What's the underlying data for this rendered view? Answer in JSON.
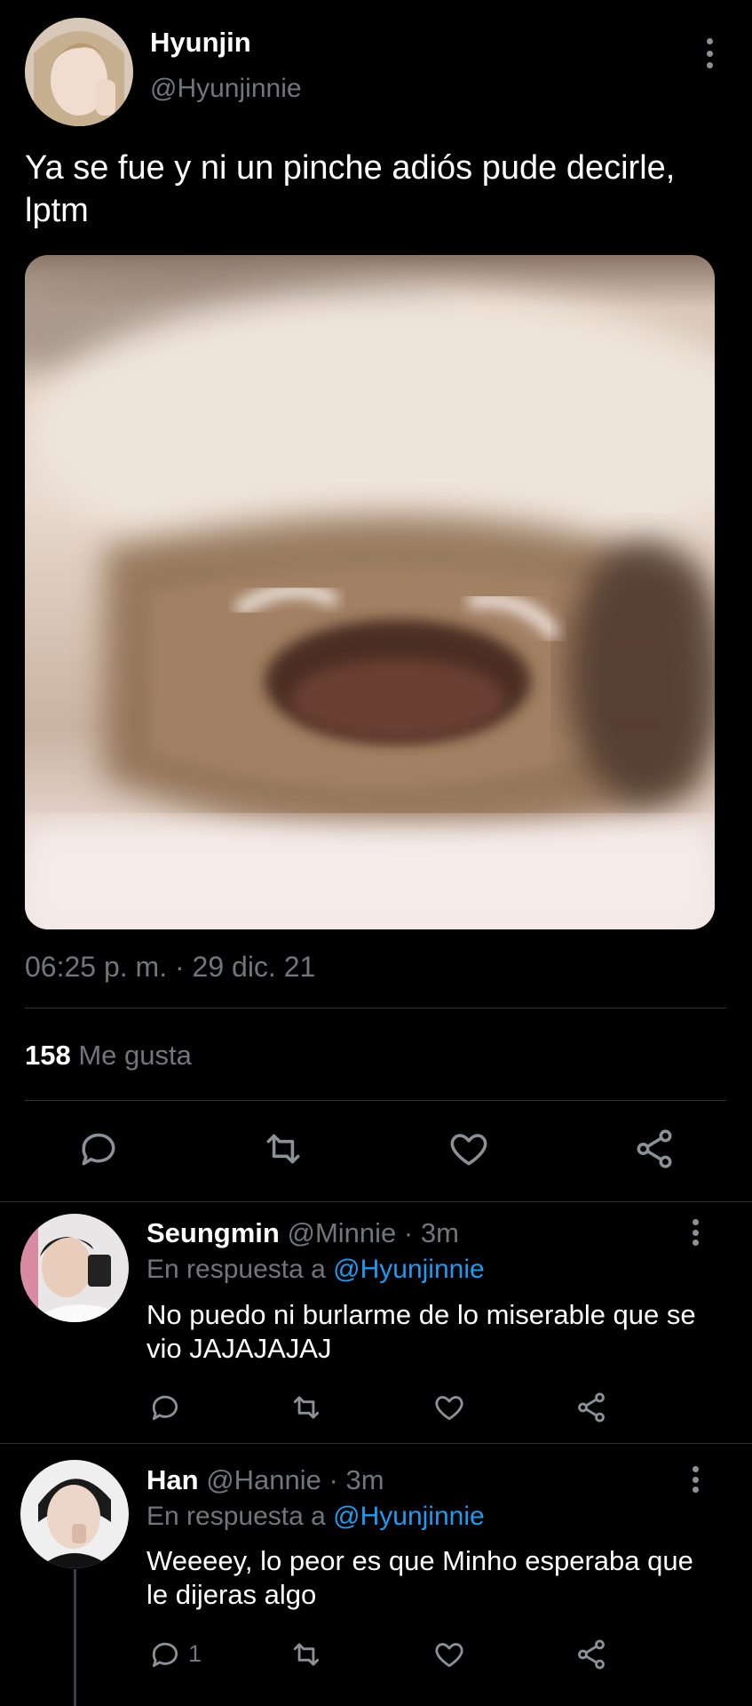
{
  "main_tweet": {
    "author_name": "Hyunjin",
    "author_handle": "@Hyunjinnie",
    "text": "Ya se fue y ni un pinche adiós pude decirle, lptm",
    "timestamp": "06:25 p. m. · 29 dic. 21",
    "likes_count": "158",
    "likes_label": "Me gusta"
  },
  "icons": {
    "reply": "reply-icon",
    "retweet": "retweet-icon",
    "like": "heart-icon",
    "share": "share-icon",
    "more": "more-vertical-icon"
  },
  "colors": {
    "background": "#000000",
    "text": "#e7e9ea",
    "muted": "#71767b",
    "link": "#1d9bf0",
    "divider": "#2f3336"
  },
  "replies": [
    {
      "name": "Seungmin",
      "handle": "@Minnie",
      "time": "· 3m",
      "reply_prefix": "En respuesta a",
      "reply_to": "@Hyunjinnie",
      "text": "No puedo ni burlarme de lo miserable que se vio JAJAJAJAJ",
      "reply_count": ""
    },
    {
      "name": "Han",
      "handle": "@Hannie",
      "time": "· 3m",
      "reply_prefix": "En respuesta a",
      "reply_to": "@Hyunjinnie",
      "text": "Weeeey, lo peor es que Minho esperaba que le dijeras algo",
      "reply_count": "1"
    }
  ]
}
